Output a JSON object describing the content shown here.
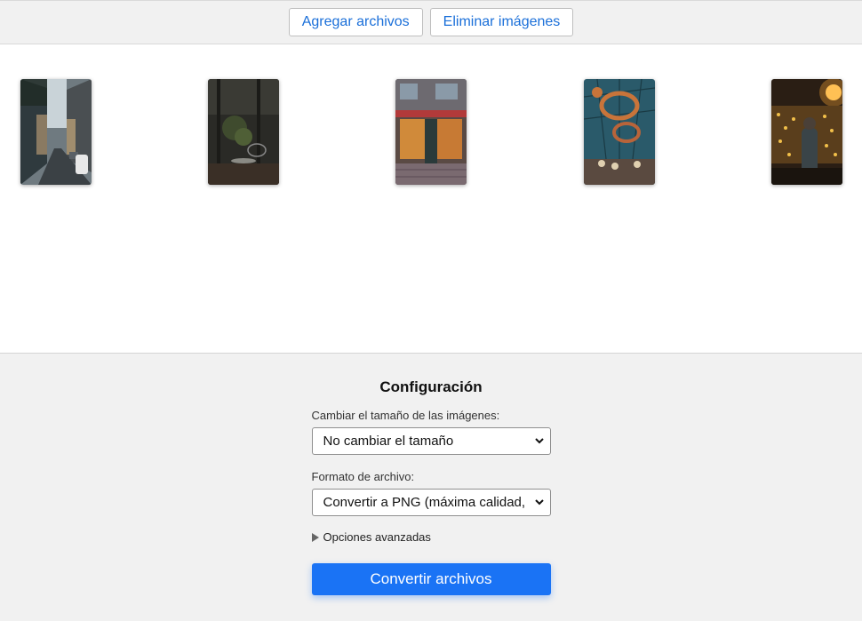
{
  "toolbar": {
    "add_label": "Agregar archivos",
    "remove_label": "Eliminar imágenes"
  },
  "gallery": {
    "thumbnails": [
      {
        "name": "street-photo"
      },
      {
        "name": "cafe-photo"
      },
      {
        "name": "storefront-photo"
      },
      {
        "name": "greenhouse-photo"
      },
      {
        "name": "lights-photo"
      }
    ]
  },
  "config": {
    "title": "Configuración",
    "resize_label": "Cambiar el tamaño de las imágenes:",
    "resize_value": "No cambiar el tamaño",
    "format_label": "Formato de archivo:",
    "format_value": "Convertir a PNG (máxima calidad, tamaño grande)",
    "advanced_label": "Opciones avanzadas",
    "convert_label": "Convertir archivos"
  },
  "colors": {
    "accent": "#1a73f5",
    "link": "#1a6fd9",
    "panel": "#f1f1f1"
  }
}
